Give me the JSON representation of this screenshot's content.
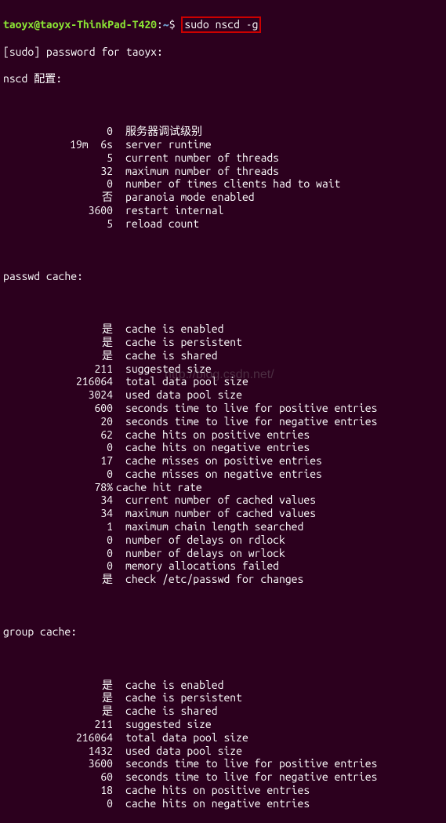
{
  "prompt": {
    "user_host": "taoyx@taoyx-ThinkPad-T420",
    "path": "~",
    "symbol": "$",
    "command": "sudo nscd -g"
  },
  "sudo_line": "[sudo] password for taoyx:",
  "config_header": "nscd 配置:",
  "config_rows": [
    {
      "v": "0",
      "l": "服务器调试级别"
    },
    {
      "v": "19m  6s",
      "l": "server runtime"
    },
    {
      "v": "5",
      "l": "current number of threads"
    },
    {
      "v": "32",
      "l": "maximum number of threads"
    },
    {
      "v": "0",
      "l": "number of times clients had to wait"
    },
    {
      "v": "否",
      "l": "paranoia mode enabled"
    },
    {
      "v": "3600",
      "l": "restart internal"
    },
    {
      "v": "5",
      "l": "reload count"
    }
  ],
  "passwd_header": "passwd cache:",
  "passwd_rows": [
    {
      "v": "是",
      "l": "cache is enabled"
    },
    {
      "v": "是",
      "l": "cache is persistent"
    },
    {
      "v": "是",
      "l": "cache is shared"
    },
    {
      "v": "211",
      "l": "suggested size"
    },
    {
      "v": "216064",
      "l": "total data pool size"
    },
    {
      "v": "3024",
      "l": "used data pool size"
    },
    {
      "v": "600",
      "l": "seconds time to live for positive entries"
    },
    {
      "v": "20",
      "l": "seconds time to live for negative entries"
    },
    {
      "v": "62",
      "l": "cache hits on positive entries"
    },
    {
      "v": "0",
      "l": "cache hits on negative entries"
    },
    {
      "v": "17",
      "l": "cache misses on positive entries"
    },
    {
      "v": "0",
      "l": "cache misses on negative entries"
    },
    {
      "v": "78%",
      "l": "cache hit rate",
      "nospace": true
    },
    {
      "v": "34",
      "l": "current number of cached values"
    },
    {
      "v": "34",
      "l": "maximum number of cached values"
    },
    {
      "v": "1",
      "l": "maximum chain length searched"
    },
    {
      "v": "0",
      "l": "number of delays on rdlock"
    },
    {
      "v": "0",
      "l": "number of delays on wrlock"
    },
    {
      "v": "0",
      "l": "memory allocations failed"
    },
    {
      "v": "是",
      "l": "check /etc/passwd for changes"
    }
  ],
  "group_header": "group cache:",
  "group_rows": [
    {
      "v": "是",
      "l": "cache is enabled"
    },
    {
      "v": "是",
      "l": "cache is persistent"
    },
    {
      "v": "是",
      "l": "cache is shared"
    },
    {
      "v": "211",
      "l": "suggested size"
    },
    {
      "v": "216064",
      "l": "total data pool size"
    },
    {
      "v": "1432",
      "l": "used data pool size"
    },
    {
      "v": "3600",
      "l": "seconds time to live for positive entries"
    },
    {
      "v": "60",
      "l": "seconds time to live for negative entries"
    },
    {
      "v": "18",
      "l": "cache hits on positive entries"
    },
    {
      "v": "0",
      "l": "cache hits on negative entries"
    }
  ],
  "watermark": "http://blog.csdn.net/"
}
